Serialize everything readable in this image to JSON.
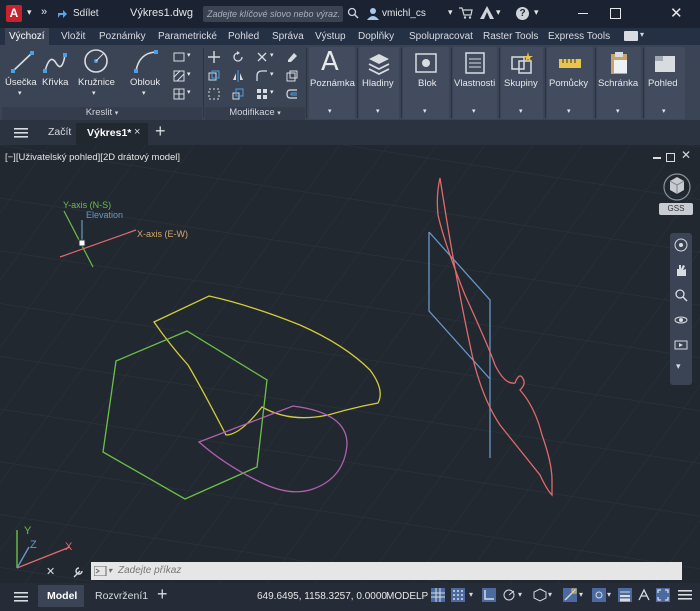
{
  "app": {
    "logo_letter": "A",
    "share_label": "Sdílet",
    "file_title": "Výkres1.dwg",
    "search_placeholder": "Zadejte klíčové slovo nebo výraz.",
    "user": "vmichl_cs"
  },
  "ribbon_tabs": [
    "Výchozí",
    "Vložit",
    "Poznámky",
    "Parametrické",
    "Pohled",
    "Správa",
    "Výstup",
    "Doplňky",
    "Spolupracovat",
    "Raster Tools",
    "Express Tools"
  ],
  "draw_panel": {
    "line": "Úsečka",
    "polyline": "Křivka",
    "circle": "Kružnice",
    "arc": "Oblouk",
    "footer": "Kreslit"
  },
  "modify_panel": {
    "footer": "Modifikace"
  },
  "big_buttons": [
    "Poznámka",
    "Hladiny",
    "Blok",
    "Vlastnosti",
    "Skupiny",
    "Pomůcky",
    "Schránka",
    "Pohled"
  ],
  "file_tabs": {
    "start": "Začít",
    "doc": "Výkres1*"
  },
  "viewport": {
    "label": "[−][Uživatelský pohled][2D drátový model]",
    "gss": "GSS"
  },
  "axes": {
    "y": "Y-axis (N-S)",
    "elev": "Elevation",
    "x": "X-axis (E-W)"
  },
  "command": {
    "placeholder": "Zadejte příkaz"
  },
  "status": {
    "model_tab": "Model",
    "layout_tab": "Rozvržení1",
    "coords": "649.6495, 1158.3257, 0.0000",
    "mode": "MODELP"
  },
  "colors": {
    "yellow": "#d4cc3a",
    "green": "#6cbf48",
    "magenta": "#b060b0",
    "red": "#e06a6a",
    "blue": "#6a96c8"
  }
}
